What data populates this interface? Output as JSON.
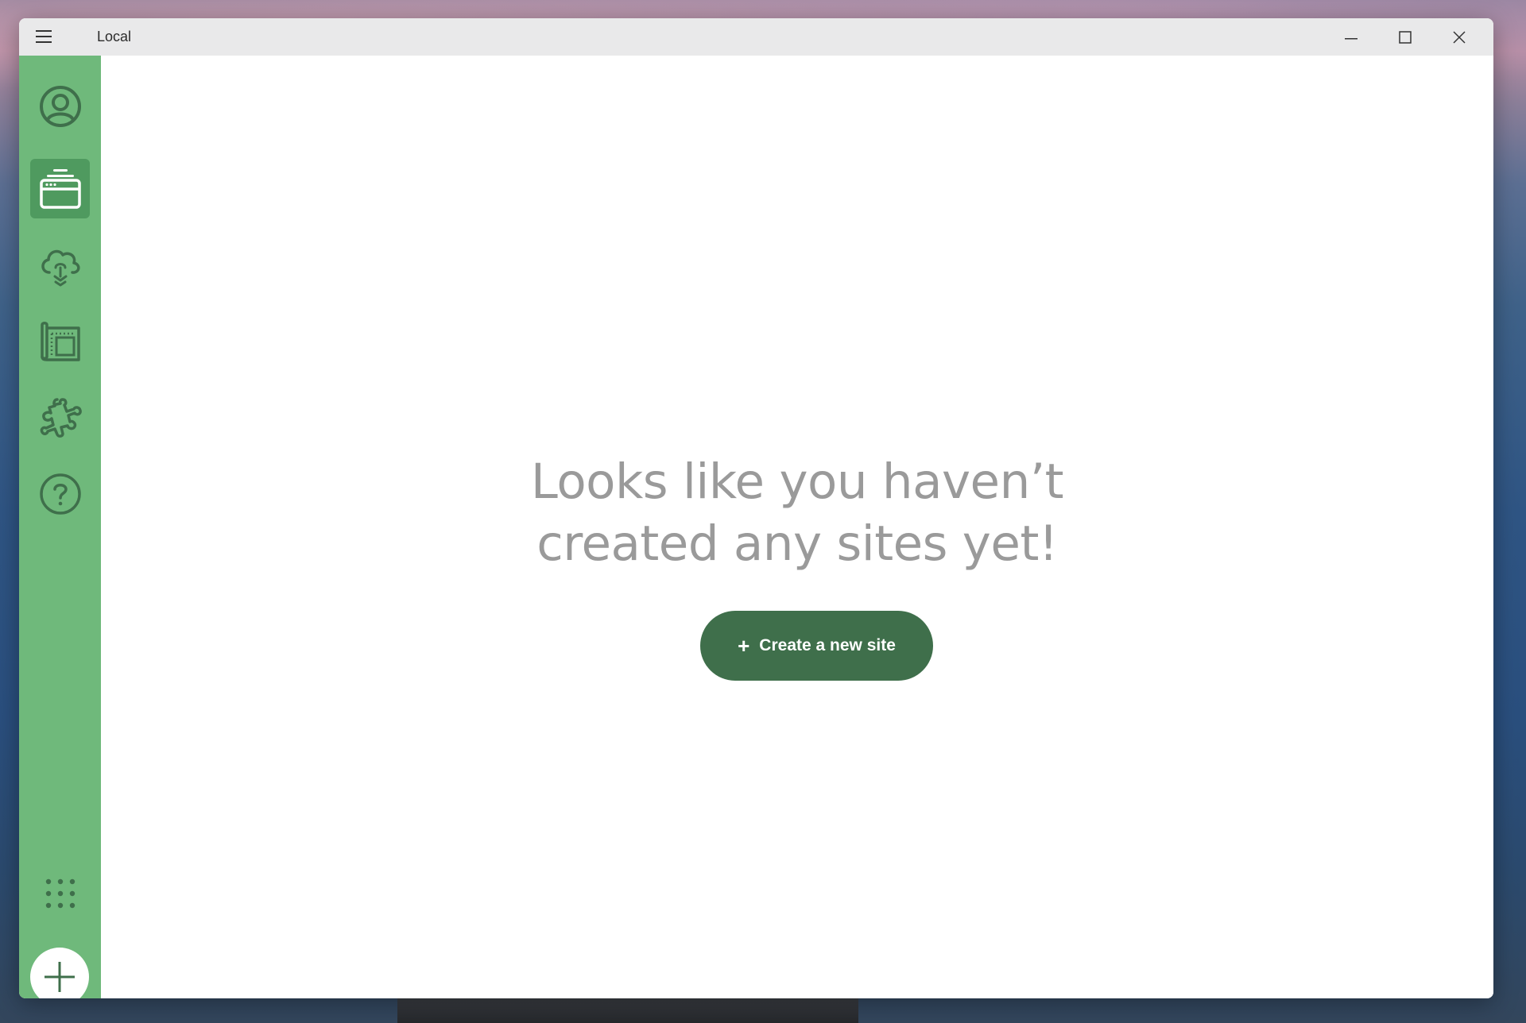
{
  "window": {
    "title": "Local"
  },
  "sidebar": {
    "items": [
      {
        "id": "account",
        "icon": "user-circle-icon",
        "active": false
      },
      {
        "id": "local-sites",
        "icon": "sites-stack-icon",
        "active": true
      },
      {
        "id": "connect",
        "icon": "cloud-sync-icon",
        "active": false
      },
      {
        "id": "blueprints",
        "icon": "blueprint-icon",
        "active": false
      },
      {
        "id": "add-ons",
        "icon": "puzzle-icon",
        "active": false
      },
      {
        "id": "help",
        "icon": "help-circle-icon",
        "active": false
      }
    ],
    "apps_icon": "grid-dots-icon",
    "add_icon": "plus-icon"
  },
  "main": {
    "empty_line1": "Looks like you haven’t",
    "empty_line2": "created any sites yet!",
    "create_button": {
      "icon": "+",
      "label": "Create a new site"
    }
  },
  "colors": {
    "sidebar_green": "#6fb97b",
    "active_item": "#4f9a5f",
    "icon_dark_green": "#3f6f4b",
    "button_green": "#3f6f4b",
    "empty_text_gray": "#9a9a9a"
  }
}
